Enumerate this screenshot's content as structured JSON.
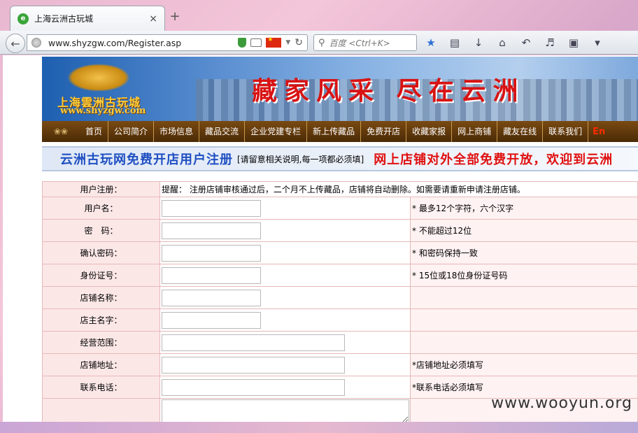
{
  "browser": {
    "tab_title": "上海云洲古玩城",
    "tab_favicon": "e",
    "tab_close": "×",
    "new_tab": "+",
    "url": "www.shyzgw.com/Register.asp",
    "search_placeholder": "百度 <Ctrl+K>",
    "icons": [
      "back-arrow-icon",
      "globe-icon",
      "shield-icon",
      "reader-icon",
      "china-flag-icon",
      "reload-icon",
      "search-icon",
      "bookmark-star-icon",
      "bookmarks-list-icon",
      "download-icon",
      "home-icon",
      "undo-icon",
      "speaker-icon",
      "crop-icon",
      "menu-icon"
    ]
  },
  "header": {
    "logo_name": "上海雲洲古玩城",
    "logo_url": "www.shyzgw.com",
    "slogan": "藏家风采  尽在云洲"
  },
  "nav": {
    "items": [
      "首页",
      "公司简介",
      "市场信息",
      "藏品交流",
      "企业党建专栏",
      "新上传藏品",
      "免费开店",
      "收藏家报",
      "网上商铺",
      "藏友在线",
      "联系我们"
    ],
    "english": "En"
  },
  "title_strip": {
    "title": "云洲古玩网免费开店用户注册",
    "note": "[请留意相关说明,每一项都必须填]",
    "marquee": "网上店铺对外全部免费开放，欢迎到云洲"
  },
  "form": {
    "notice_label": "用户注册：",
    "notice_text": "提醒： 注册店铺审核通过后，二个月不上传藏品，店铺将自动删除。如需要请重新申请注册店铺。",
    "rows": [
      {
        "label": "用户名：",
        "hint": "* 最多12个字符，六个汉字"
      },
      {
        "label": "密　码：",
        "hint": "* 不能超过12位"
      },
      {
        "label": "确认密码：",
        "hint": "* 和密码保持一致"
      },
      {
        "label": "身份证号：",
        "hint": "* 15位或18位身份证号码"
      },
      {
        "label": "店铺名称：",
        "hint": ""
      },
      {
        "label": "店主名字：",
        "hint": ""
      },
      {
        "label": "经营范围：",
        "hint": ""
      },
      {
        "label": "店铺地址：",
        "hint": "*店铺地址必须填写"
      },
      {
        "label": "联系电话：",
        "hint": "*联系电话必须填写"
      }
    ]
  },
  "watermark": "www.wooyun.org"
}
